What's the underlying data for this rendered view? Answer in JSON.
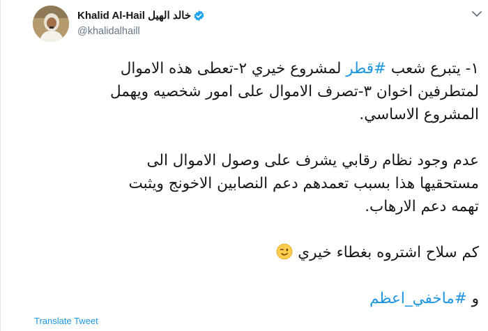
{
  "author": {
    "display_name": "Khalid Al-Hail خالد الهيل",
    "handle": "@khalidalhaill"
  },
  "tweet": {
    "line1_prefix": "١- يتبرع شعب ",
    "hashtag_qatar": "#قطر",
    "line1_suffix": " لمشروع خيري ٢-تعطى هذه الاموال",
    "line2": "لمتطرفين اخوان ٣-تصرف الاموال على امور شخصيه ويهمل",
    "line3": "المشروع الاساسي.",
    "line4": "عدم وجود نظام رقابي يشرف على وصول الاموال الى",
    "line5": "مستحقيها هذا بسبب تعمدهم دعم النصابين الاخونج ويثبت",
    "line6": "تهمه دعم الارهاب.",
    "line7": "كم سلاح اشتروه بغطاء خيري",
    "line8_prefix": "و ",
    "hashtag_hidden": "#ماخفي_اعظم"
  },
  "actions": {
    "translate": "Translate Tweet"
  },
  "colors": {
    "link": "#1b95e0",
    "text": "#14171a",
    "secondary": "#657786"
  },
  "icons": {
    "verified": "verified-badge-icon",
    "menu": "chevron-down-icon",
    "emoji": "winking-face-icon"
  }
}
